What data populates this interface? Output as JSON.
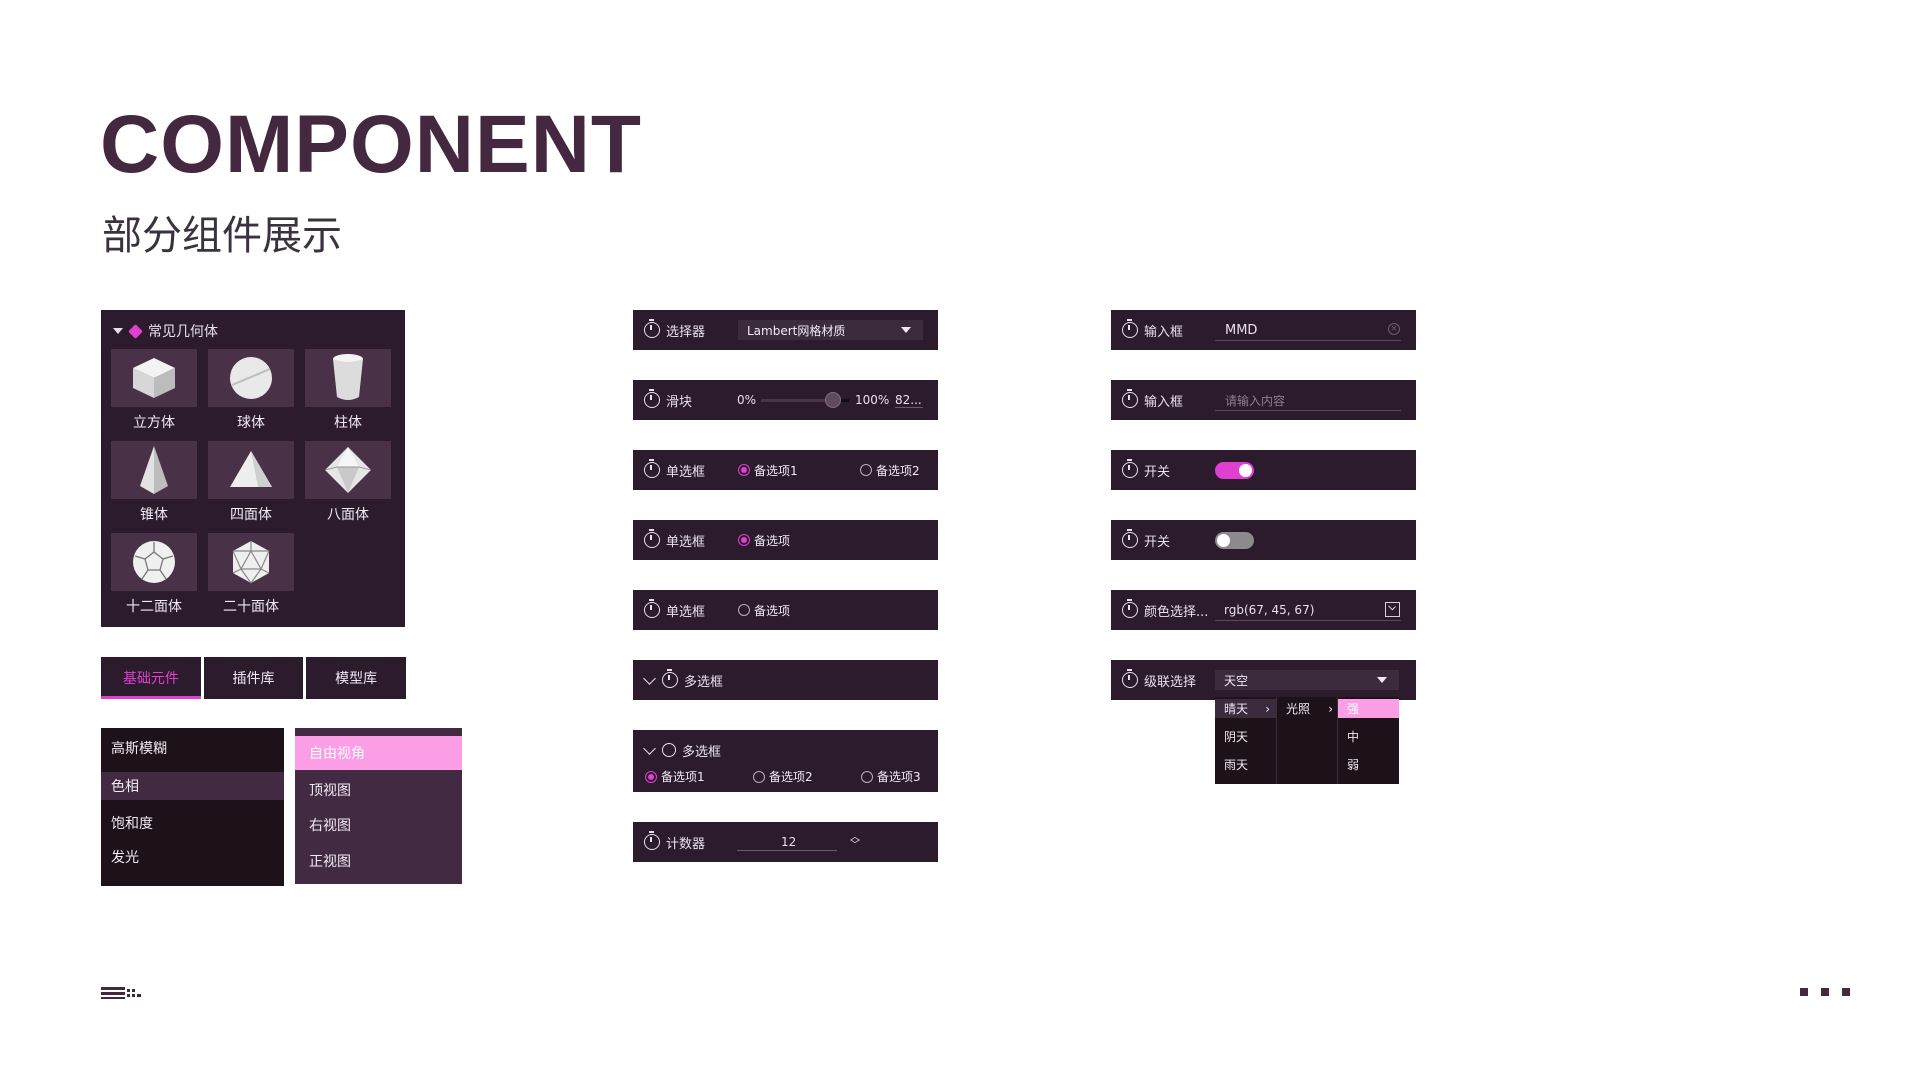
{
  "header": {
    "title": "COMPONENT",
    "subtitle": "部分组件展示"
  },
  "geometry_panel": {
    "title": "常见几何体",
    "items": [
      {
        "label": "立方体",
        "icon": "cube-icon"
      },
      {
        "label": "球体",
        "icon": "sphere-icon"
      },
      {
        "label": "柱体",
        "icon": "cylinder-icon"
      },
      {
        "label": "锥体",
        "icon": "cone-icon"
      },
      {
        "label": "四面体",
        "icon": "tetrahedron-icon"
      },
      {
        "label": "八面体",
        "icon": "octahedron-icon"
      },
      {
        "label": "十二面体",
        "icon": "dodecahedron-icon"
      },
      {
        "label": "二十面体",
        "icon": "icosahedron-icon"
      }
    ]
  },
  "tabs": {
    "items": [
      "基础元件",
      "插件库",
      "模型库"
    ],
    "active": 0
  },
  "menu_filters": {
    "items": [
      "高斯模糊",
      "色相",
      "饱和度",
      "发光"
    ],
    "selected": 1
  },
  "menu_views": {
    "items": [
      "自由视角",
      "顶视图",
      "右视图",
      "正视图"
    ],
    "selected": 0
  },
  "widgets_col2": {
    "selector": {
      "label": "选择器",
      "value": "Lambert网格材质"
    },
    "slider": {
      "label": "滑块",
      "min_label": "0%",
      "max_label": "100%",
      "value_text": "82...",
      "value": 0.82
    },
    "radio_two": {
      "label": "单选框",
      "options": [
        "备选项1",
        "备选项2"
      ],
      "selected": 0
    },
    "radio_single_on": {
      "label": "单选框",
      "option": "备选项",
      "checked": true
    },
    "radio_single_off": {
      "label": "单选框",
      "option": "备选项",
      "checked": false
    },
    "checkbox_collapsed": {
      "label": "多选框"
    },
    "checkbox_expanded": {
      "label": "多选框",
      "options": [
        "备选项1",
        "备选项2",
        "备选项3"
      ],
      "selected": 0
    },
    "counter": {
      "label": "计数器",
      "value": "12"
    }
  },
  "widgets_col3": {
    "input_filled": {
      "label": "输入框",
      "value": "MMD"
    },
    "input_empty": {
      "label": "输入框",
      "placeholder": "请输入内容"
    },
    "switch_on": {
      "label": "开关",
      "on": true
    },
    "switch_off": {
      "label": "开关",
      "on": false
    },
    "color_picker": {
      "label": "颜色选择...",
      "value": "rgb(67, 45, 67)"
    },
    "cascader": {
      "label": "级联选择",
      "value": "天空",
      "col1": [
        "晴天",
        "阴天",
        "雨天"
      ],
      "col2": [
        "光照"
      ],
      "col3": [
        "强",
        "中",
        "弱"
      ]
    }
  },
  "colors": {
    "title": "#43283f",
    "panel_bg": "#2b1b2c",
    "accent": "#e040d0",
    "highlight_pink": "#fb9ee6",
    "switch_on": "#e040d0",
    "switch_off": "#8b8b8b"
  }
}
